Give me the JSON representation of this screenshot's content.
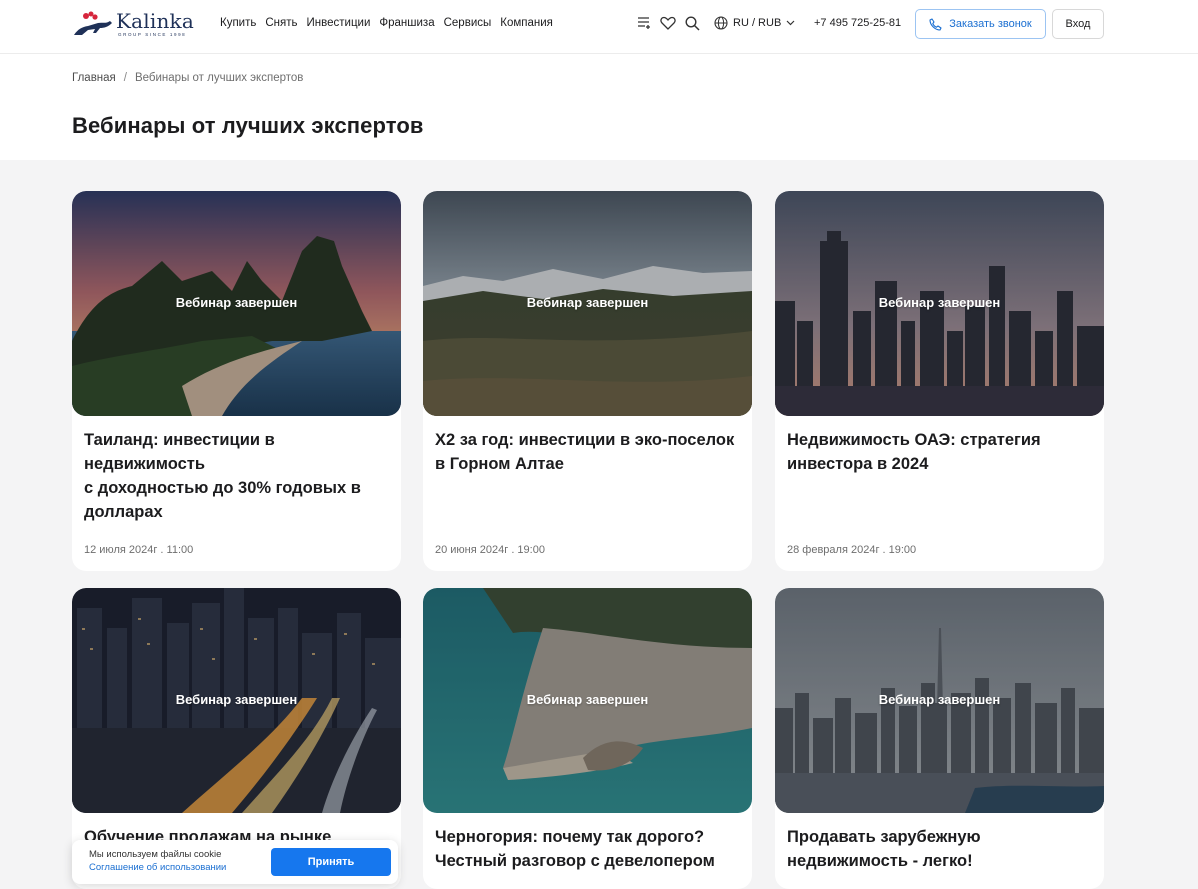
{
  "header": {
    "logo_text": "Kalinka",
    "logo_sub": "GROUP SINCE 1998",
    "nav": [
      "Купить",
      "Снять",
      "Инвестиции",
      "Франшиза",
      "Сервисы",
      "Компания"
    ],
    "lang": "RU / RUB",
    "phone": "+7 495 725-25-81",
    "call_label": "Заказать звонок",
    "login_label": "Вход"
  },
  "breadcrumb": {
    "home": "Главная",
    "separator": "/",
    "current": "Вебинары от лучших экспертов"
  },
  "page_title": "Вебинары от лучших экспертов",
  "cards": [
    {
      "status": "Вебинар завершен",
      "title": "Таиланд: инвестиции в недвижимость\nс доходностью до 30% годовых в долларах",
      "date": "12 июля 2024г . 11:00",
      "image": "thailand-coast"
    },
    {
      "status": "Вебинар завершен",
      "title": "Х2 за год: инвестиции в эко-поселок в Горном Алтае",
      "date": "20 июня 2024г . 19:00",
      "image": "altai-mountains"
    },
    {
      "status": "Вебинар завершен",
      "title": "Недвижимость ОАЭ: стратегия инвестора в 2024",
      "date": "28 февраля 2024г . 19:00",
      "image": "dubai-skyline-dusk"
    },
    {
      "status": "Вебинар завершен",
      "title": "Обучение продажам на рынке",
      "date": "",
      "image": "night-city-highway"
    },
    {
      "status": "Вебинар завершен",
      "title": "Черногория: почему так дорого? Честный разговор с девелопером",
      "date": "",
      "image": "montenegro-coast"
    },
    {
      "status": "Вебинар завершен",
      "title": "Продавать зарубежную недвижимость - легко!",
      "date": "",
      "image": "dubai-skyline-day"
    }
  ],
  "cookie": {
    "text": "Мы используем файлы cookie",
    "link": "Соглашение об использовании",
    "accept": "Принять"
  },
  "colors": {
    "accent": "#1677ee",
    "brand": "#1f3158",
    "bg": "#f4f4f5"
  }
}
